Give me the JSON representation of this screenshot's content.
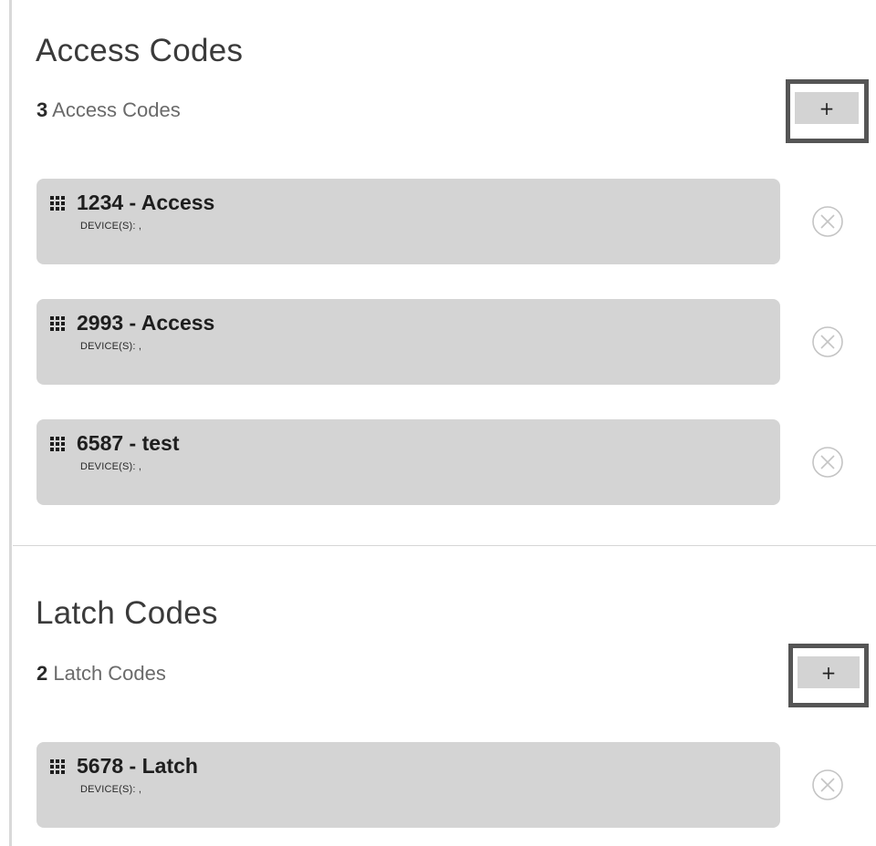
{
  "access_section": {
    "title": "Access Codes",
    "count": "3",
    "count_label": " Access Codes",
    "add_label": "+",
    "items": [
      {
        "title": "1234 - Access",
        "devices": "DEVICE(S): ,"
      },
      {
        "title": "2993 - Access",
        "devices": "DEVICE(S): ,"
      },
      {
        "title": "6587 - test",
        "devices": "DEVICE(S): ,"
      }
    ]
  },
  "latch_section": {
    "title": "Latch Codes",
    "count": "2",
    "count_label": " Latch Codes",
    "add_label": "+",
    "items": [
      {
        "title": "5678 - Latch",
        "devices": "DEVICE(S): ,"
      }
    ]
  },
  "icons": {
    "code_item": "keypad-icon",
    "remove": "remove-circle-x-icon"
  }
}
